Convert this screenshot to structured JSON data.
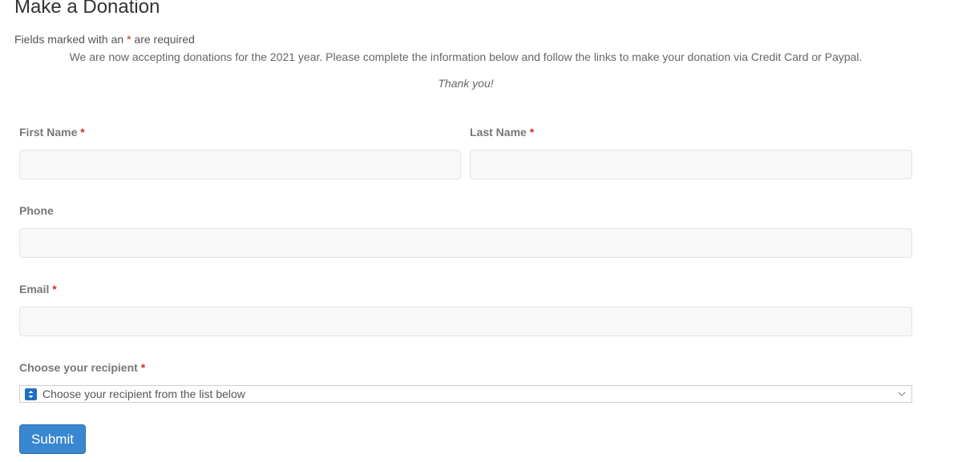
{
  "page": {
    "title": "Make a Donation",
    "required_note_prefix": "Fields marked with an ",
    "required_note_star": "*",
    "required_note_suffix": " are required",
    "intro": "We are now accepting donations for the 2021 year. Please complete the information below and follow the links to make your donation via Credit Card or Paypal.",
    "thanks": "Thank you!"
  },
  "form": {
    "required_marker": "*",
    "first_name": {
      "label": "First Name",
      "value": "",
      "required": true
    },
    "last_name": {
      "label": "Last Name",
      "value": "",
      "required": true
    },
    "phone": {
      "label": "Phone",
      "value": "",
      "required": false
    },
    "email": {
      "label": "Email",
      "value": "",
      "required": true
    },
    "recipient": {
      "label": "Choose your recipient",
      "selected": "Choose your recipient from the list below",
      "required": true,
      "icon": "sort-arrows-icon"
    },
    "submit_label": "Submit"
  },
  "colors": {
    "required_star": "#c9302c",
    "submit_bg": "#3a87d1",
    "select_icon_bg": "#1f6fc1",
    "input_bg": "#f8f8f8"
  }
}
